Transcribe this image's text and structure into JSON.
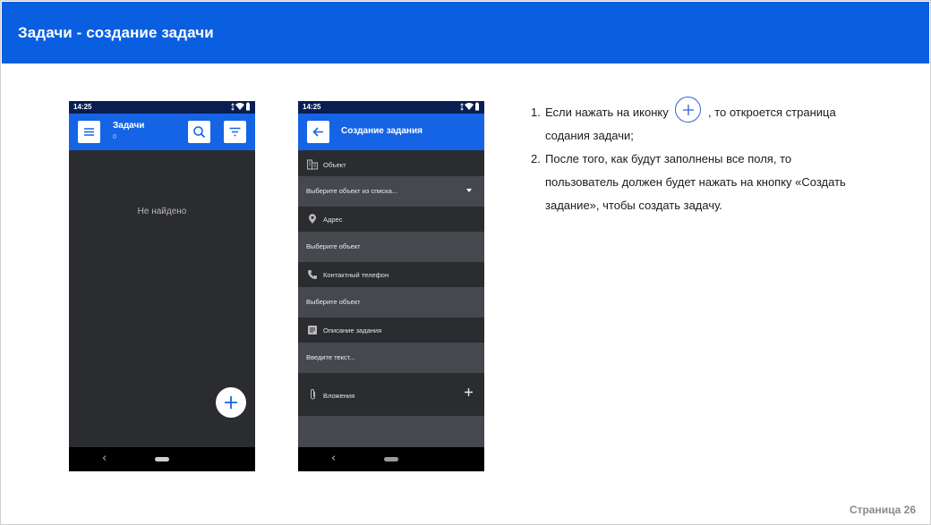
{
  "header": {
    "title": "Задачи - создание задачи"
  },
  "phone1": {
    "status_time": "14:25",
    "appbar": {
      "title": "Задачи",
      "count": "0"
    },
    "empty_text": "Не найдено",
    "nav_back": "‹"
  },
  "phone2": {
    "status_time": "14:25",
    "appbar": {
      "title": "Создание задания"
    },
    "object": {
      "label": "Объект",
      "value": "Выберите объект из списка..."
    },
    "address": {
      "label": "Адрес",
      "value": "Выберите объект"
    },
    "phone": {
      "label": "Контактный телефон",
      "value": "Выберите объект"
    },
    "description": {
      "label": "Описание задания",
      "value": "Введите текст..."
    },
    "attachments": {
      "label": "Вложения"
    },
    "nav_back": "‹"
  },
  "instructions": {
    "step1": {
      "num": "1.",
      "before": "Если нажать на иконку",
      "after": ", то откроется страница",
      "line2": "содания задачи;"
    },
    "step2": {
      "num": "2.",
      "line1": "После того, как будут заполнены все поля, то",
      "line2": "пользователь должен будет нажать на кнопку «Создать",
      "line3": "задание», чтобы создать задачу."
    }
  },
  "footer": {
    "page_label": "Страница 26"
  },
  "colors": {
    "header_blue": "#0a5fe0",
    "appbar_blue": "#1564e6",
    "dark_bg": "#2b2c30",
    "field_bg": "#46484d"
  }
}
